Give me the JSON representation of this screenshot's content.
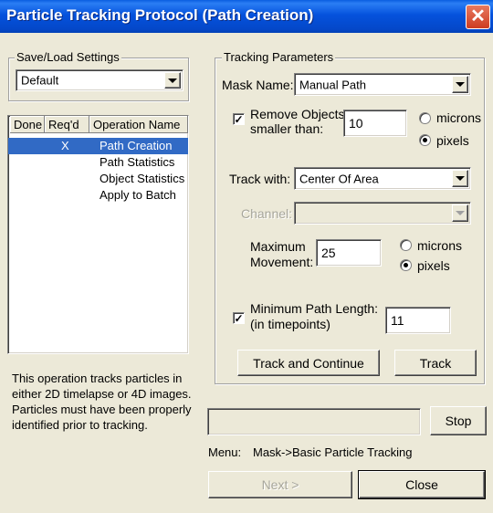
{
  "window": {
    "title": "Particle Tracking Protocol (Path Creation)",
    "close_glyph": "✕"
  },
  "settings": {
    "group_label": "Save/Load Settings",
    "selected": "Default"
  },
  "operations": {
    "columns": [
      "Done",
      "Req'd",
      "Operation Name"
    ],
    "rows": [
      {
        "done": "",
        "reqd": "X",
        "name": "Path Creation",
        "selected": true
      },
      {
        "done": "",
        "reqd": "",
        "name": "Path Statistics",
        "selected": false
      },
      {
        "done": "",
        "reqd": "",
        "name": "Object Statistics",
        "selected": false
      },
      {
        "done": "",
        "reqd": "",
        "name": "Apply to Batch",
        "selected": false
      }
    ]
  },
  "description": {
    "line1": "This operation tracks particles in",
    "line2": "either 2D timelapse or 4D images.",
    "line3": "Particles must have been properly",
    "line4": "identified prior to tracking."
  },
  "tracking": {
    "group_label": "Tracking Parameters",
    "mask_label": "Mask Name:",
    "mask_value": "Manual Path",
    "remove_line1": "Remove Objects",
    "remove_line2": "smaller than:",
    "remove_checked": true,
    "remove_value": "10",
    "remove_units": {
      "microns": "microns",
      "pixels": "pixels",
      "selected": "pixels"
    },
    "track_with_label": "Track with:",
    "track_with_value": "Center Of Area",
    "channel_label": "Channel:",
    "channel_value": "",
    "max_move_line1": "Maximum",
    "max_move_line2": "Movement:",
    "max_move_value": "25",
    "max_move_units": {
      "microns": "microns",
      "pixels": "pixels",
      "selected": "pixels"
    },
    "min_path_line1": "Minimum Path Length:",
    "min_path_line2": "(in timepoints)",
    "min_path_checked": true,
    "min_path_value": "11",
    "track_continue_label": "Track and Continue",
    "track_label": "Track"
  },
  "progress": {
    "value": 0
  },
  "stop_label": "Stop",
  "menu": {
    "label": "Menu:",
    "path": "Mask->Basic Particle Tracking"
  },
  "footer": {
    "next_label": "Next >",
    "close_label": "Close"
  },
  "colors": {
    "titlebar": "#0552dd",
    "selection": "#316ac5",
    "dialog_bg": "#ece9d8"
  },
  "icons": {
    "close": "close-icon",
    "dropdown": "chevron-down-icon",
    "check": "checkmark-icon"
  }
}
